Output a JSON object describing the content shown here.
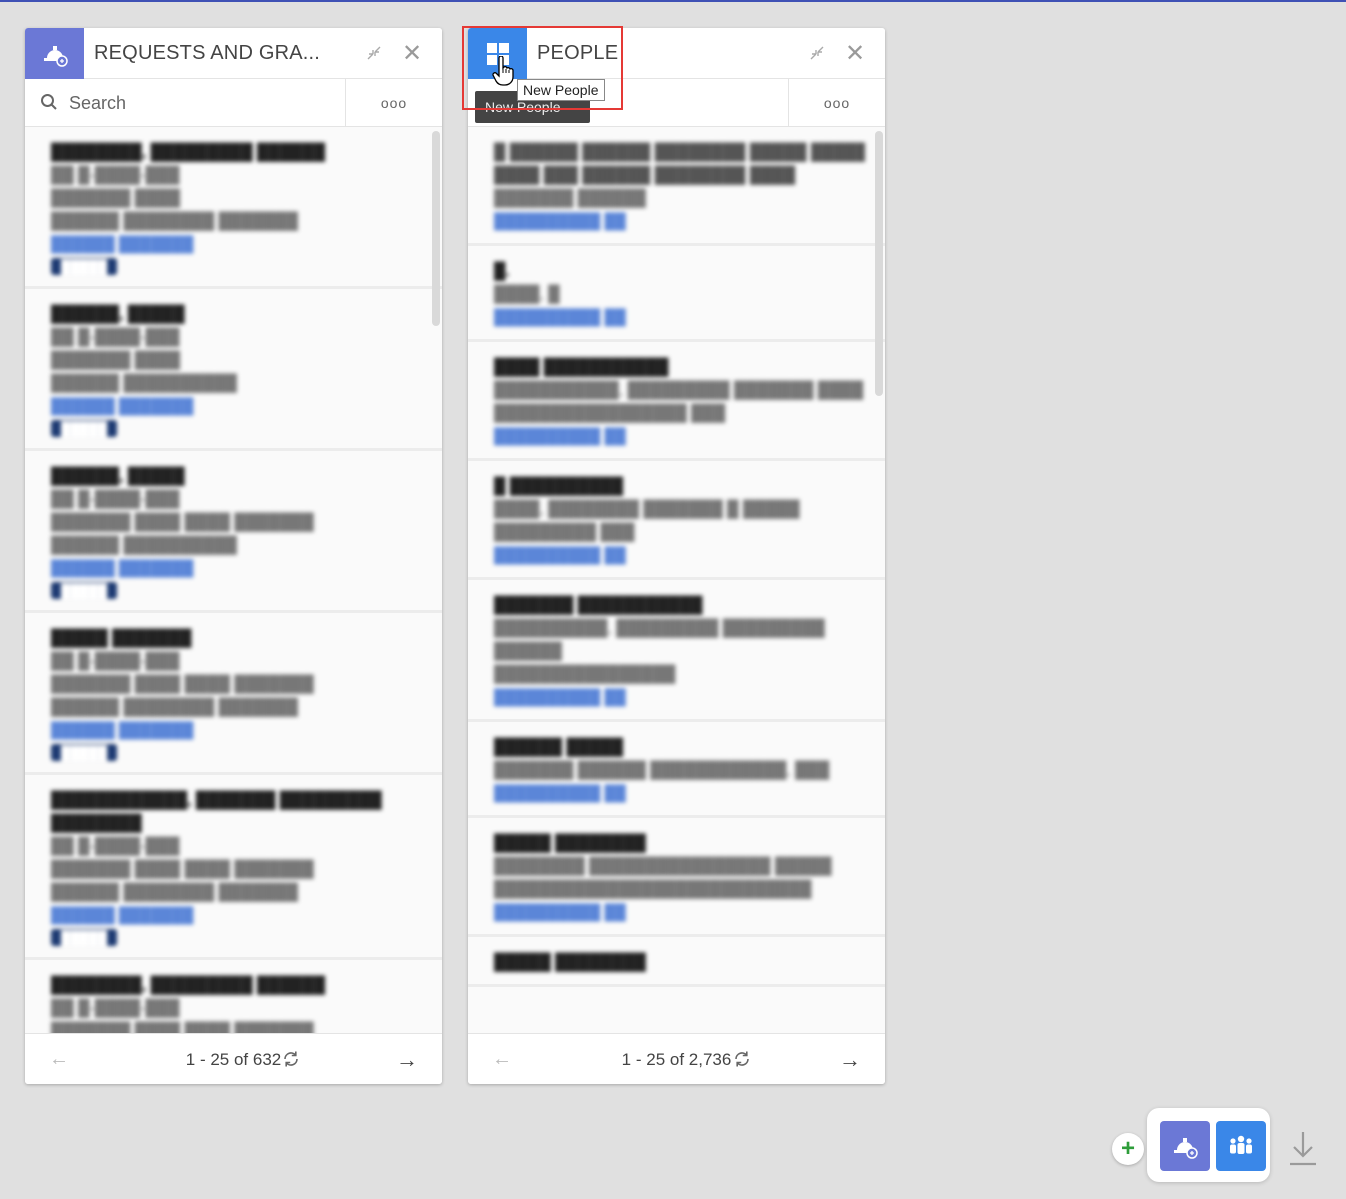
{
  "panels": [
    {
      "title": "REQUESTS AND GRA...",
      "icon": "grant-request-icon",
      "search_placeholder": "Search",
      "more_label": "ooo",
      "pagination": "1 - 25 of 632",
      "prev_label": "←",
      "next_label": "→"
    },
    {
      "title": "PEOPLE",
      "icon": "new-people-icon",
      "search_placeholder": "",
      "more_label": "ooo",
      "pagination": "1 - 25 of 2,736",
      "prev_label": "←",
      "next_label": "→"
    }
  ],
  "tooltip": {
    "label": "New People",
    "dark_label": "New People"
  },
  "dock": {
    "add_label": "+",
    "items": [
      "grant-request-icon",
      "people-group-icon"
    ],
    "download": "download-icon"
  },
  "colors": {
    "requests_accent": "#6b78d6",
    "people_accent": "#3a87e8",
    "highlight": "#e53935",
    "add_green": "#2e9d3a"
  }
}
